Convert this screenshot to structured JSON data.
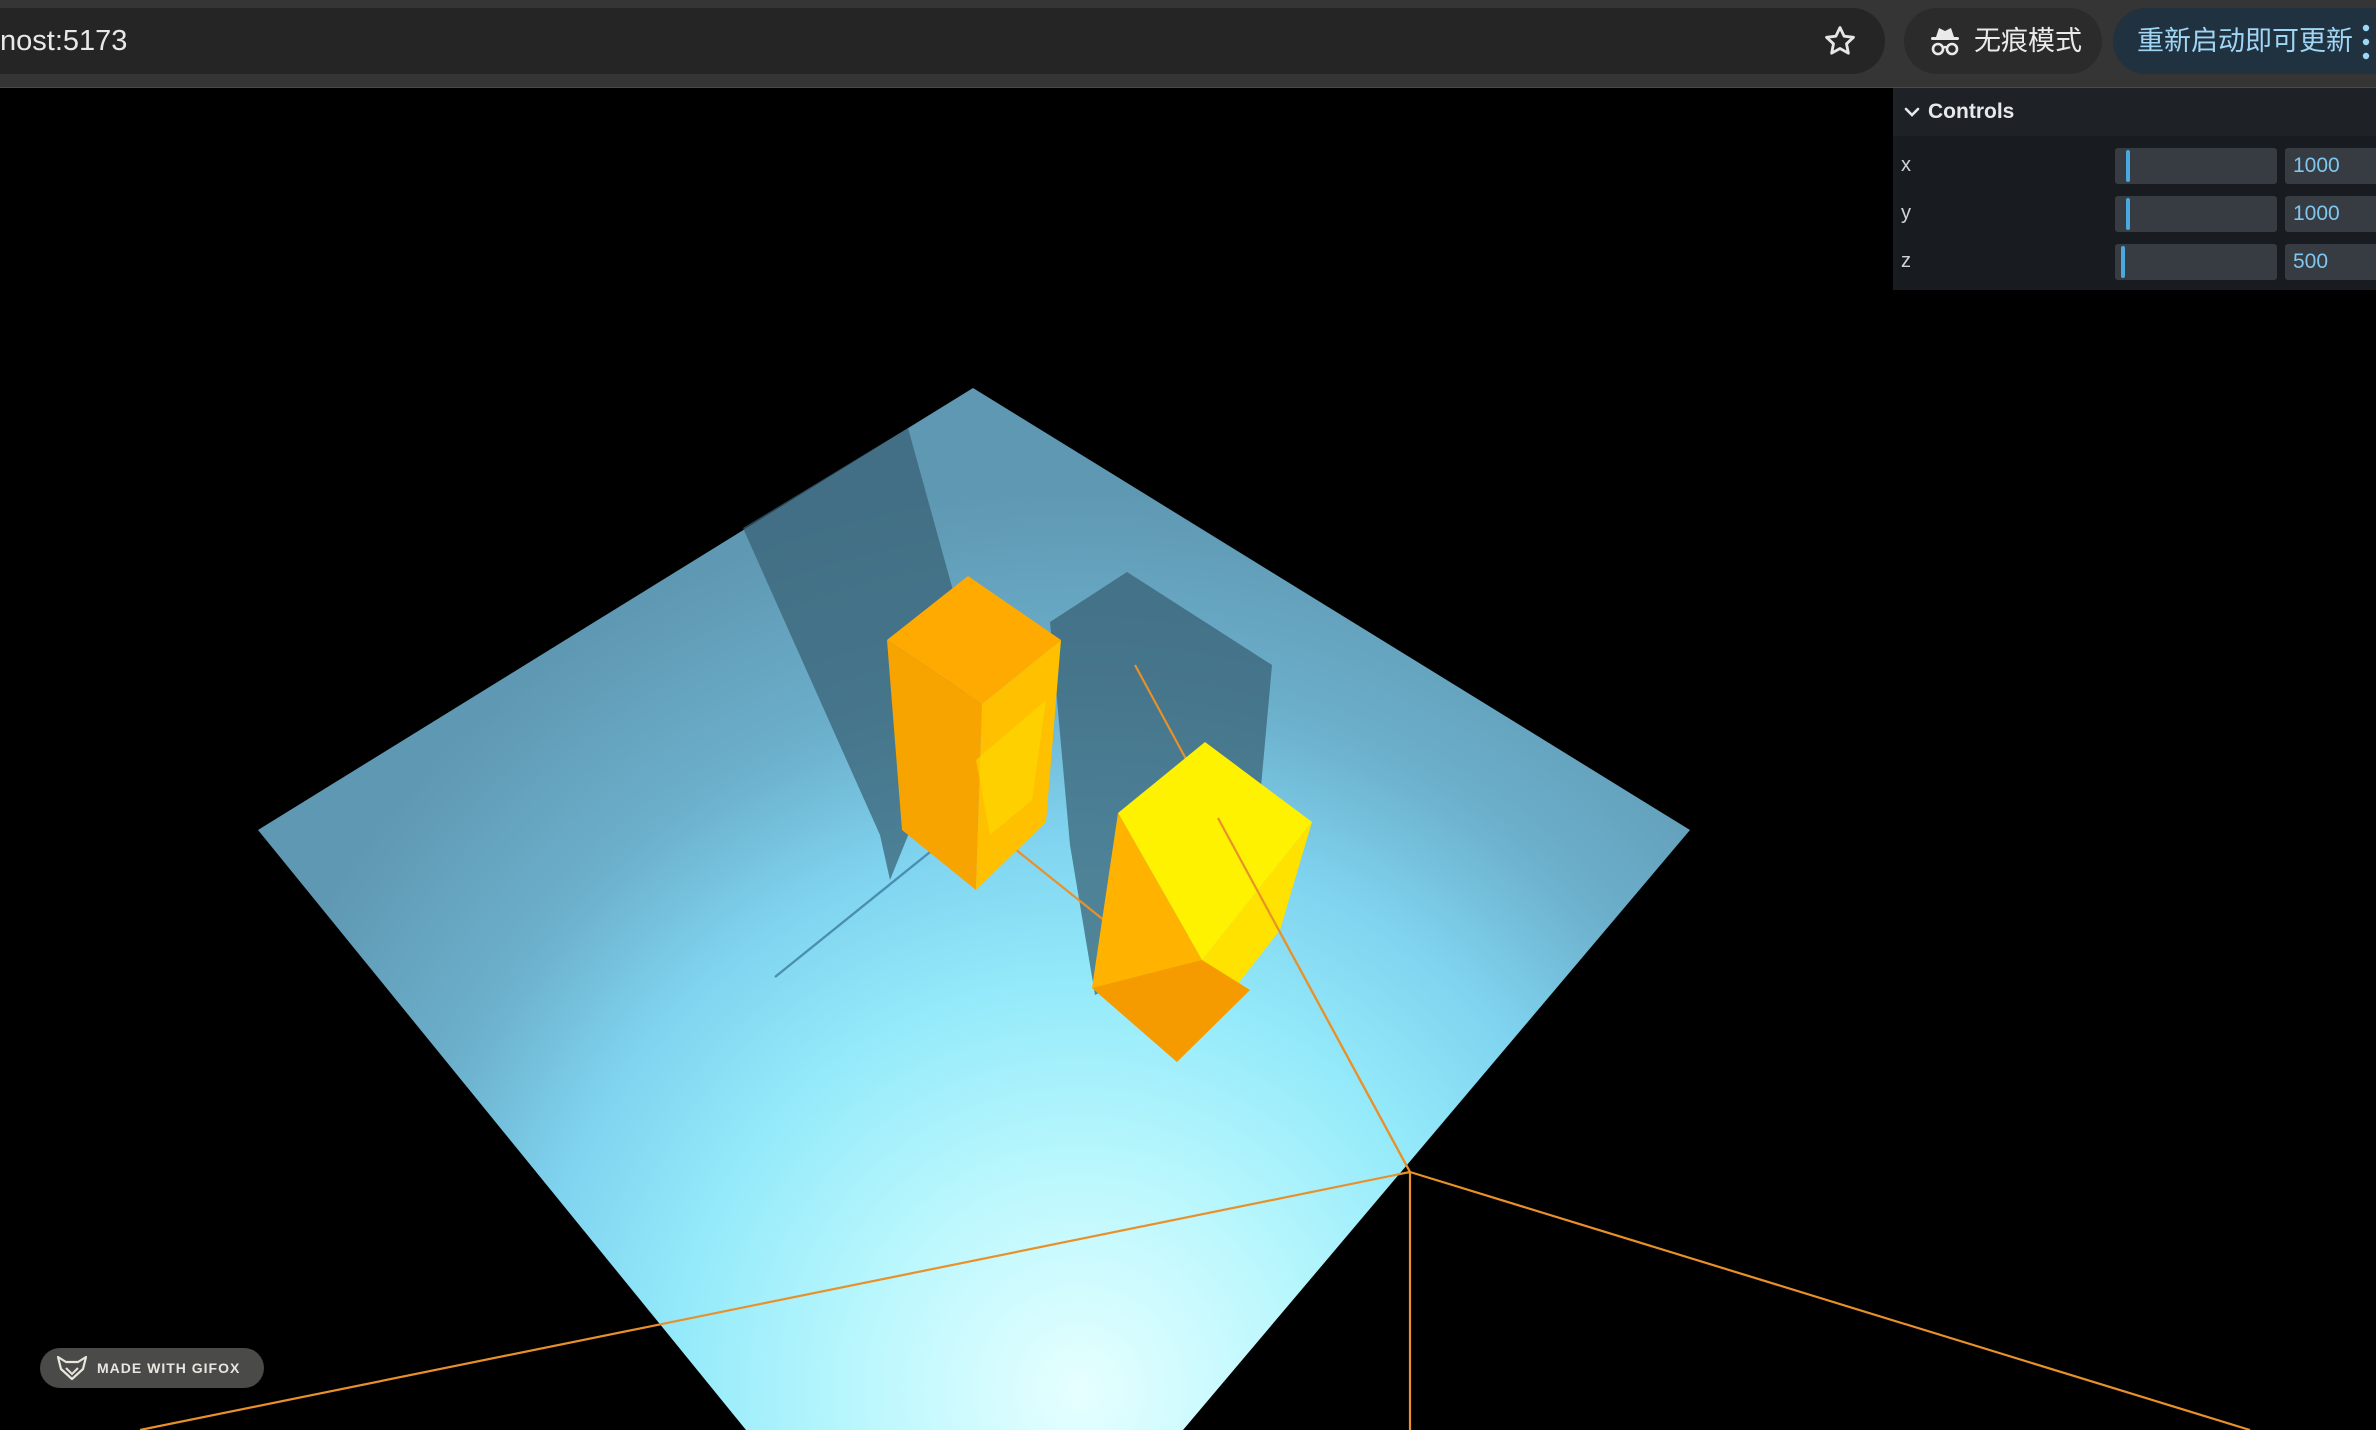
{
  "browser": {
    "url": "nost:5173",
    "incognito_label": "无痕模式",
    "update_label": "重新启动即可更新",
    "icons": {
      "bookmark": "star-outline-icon",
      "incognito": "incognito-icon",
      "menu": "kebab-menu-icon"
    }
  },
  "controls": {
    "title": "Controls",
    "rows": [
      {
        "label": "x",
        "value": "1000",
        "slider_fraction": 0.07
      },
      {
        "label": "y",
        "value": "1000",
        "slider_fraction": 0.07
      },
      {
        "label": "z",
        "value": "500",
        "slider_fraction": 0.035
      }
    ],
    "colors": {
      "accent": "#4ba9e0",
      "value_text": "#7fc6f0"
    }
  },
  "scene": {
    "background": "#000000",
    "plane_colors": {
      "light": "#d8fdff",
      "mid": "#8fe8f8",
      "dark": "#5f9bb4"
    },
    "box_colors": {
      "front": "#ffb300",
      "light": "#ffe600",
      "dark": "#f59b00"
    },
    "helper_line_color": "#e8902a"
  },
  "watermark": {
    "text": "MADE WITH GIFOX"
  }
}
